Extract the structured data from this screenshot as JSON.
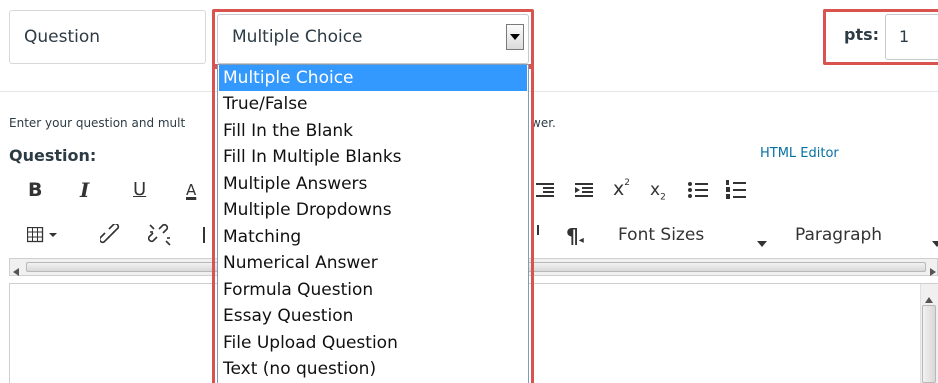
{
  "question_title": "Question",
  "question_type": {
    "selected": "Multiple Choice",
    "options": [
      "Multiple Choice",
      "True/False",
      "Fill In the Blank",
      "Fill In Multiple Blanks",
      "Multiple Answers",
      "Multiple Dropdowns",
      "Matching",
      "Numerical Answer",
      "Formula Question",
      "Essay Question",
      "File Upload Question",
      "Text (no question)"
    ]
  },
  "points": {
    "label": "pts:",
    "value": "1"
  },
  "instructions": {
    "start": "Enter your question and mult",
    "end": "wer."
  },
  "question_label": "Question:",
  "html_editor_link": "HTML Editor",
  "toolbar": {
    "bold": "B",
    "italic": "I",
    "underline": "U",
    "font_color": "A",
    "superscript_base": "x",
    "superscript_mark": "2",
    "subscript_base": "x",
    "subscript_mark": "2",
    "font_sizes": "Font Sizes",
    "paragraph": "Paragraph"
  },
  "colors": {
    "highlight": "#d9534f",
    "selected_option": "#3399ff",
    "link": "#0770a3"
  }
}
